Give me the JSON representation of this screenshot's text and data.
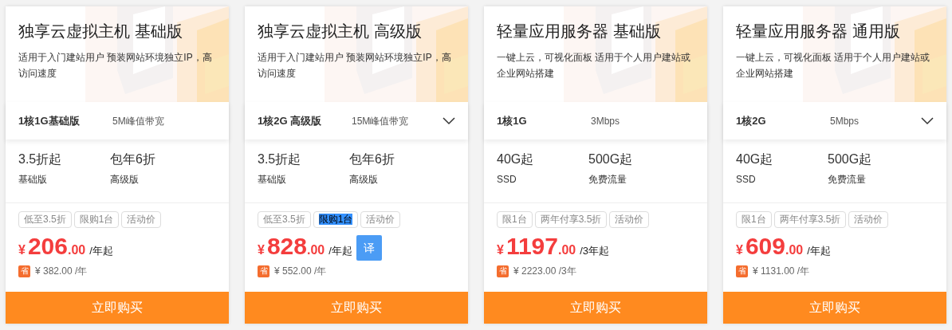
{
  "cards": [
    {
      "title": "独享云虚拟主机 基础版",
      "description": "适用于入门建站用户 预装网站环境独立IP，高访问速度",
      "spec": "1核1G基础版",
      "bandwidth": "5M峰值带宽",
      "has_dropdown": false,
      "features": [
        {
          "value": "3.5折起",
          "label": "基础版"
        },
        {
          "value": "包年6折",
          "label": "高级版"
        }
      ],
      "tags": [
        {
          "text": "低至3.5折",
          "highlighted": false
        },
        {
          "text": "限购1台",
          "highlighted": false
        },
        {
          "text": "活动价",
          "highlighted": false
        }
      ],
      "currency": "¥",
      "price": "206",
      "decimals": ".00",
      "unit": "/年起",
      "save_badge": "省",
      "saving": "¥ 382.00 /年",
      "buy": "立即购买"
    },
    {
      "title": "独享云虚拟主机 高级版",
      "description": "适用于入门建站用户 预装网站环境独立IP，高访问速度",
      "spec": "1核2G 高级版",
      "bandwidth": "15M峰值带宽",
      "has_dropdown": true,
      "features": [
        {
          "value": "3.5折起",
          "label": "基础版"
        },
        {
          "value": "包年6折",
          "label": "高级版"
        }
      ],
      "tags": [
        {
          "text": "低至3.5折",
          "highlighted": false
        },
        {
          "text": "限购1台",
          "highlighted": true
        },
        {
          "text": "活动价",
          "highlighted": false
        }
      ],
      "currency": "¥",
      "price": "828",
      "decimals": ".00",
      "unit": "/年起",
      "save_badge": "省",
      "saving": "¥ 552.00 /年",
      "buy": "立即购买",
      "translate_button": "译"
    },
    {
      "title": "轻量应用服务器 基础版",
      "description": "一键上云，可视化面板 适用于个人用户建站或企业网站搭建",
      "spec": "1核1G",
      "bandwidth": "3Mbps",
      "has_dropdown": false,
      "features": [
        {
          "value": "40G起",
          "label": "SSD"
        },
        {
          "value": "500G起",
          "label": "免费流量"
        }
      ],
      "tags": [
        {
          "text": "限1台",
          "highlighted": false
        },
        {
          "text": "两年付享3.5折",
          "highlighted": false
        },
        {
          "text": "活动价",
          "highlighted": false
        }
      ],
      "currency": "¥",
      "price": "1197",
      "decimals": ".00",
      "unit": "/3年起",
      "save_badge": "省",
      "saving": "¥ 2223.00 /3年",
      "buy": "立即购买"
    },
    {
      "title": "轻量应用服务器 通用版",
      "description": "一键上云，可视化面板 适用于个人用户建站或企业网站搭建",
      "spec": "1核2G",
      "bandwidth": "5Mbps",
      "has_dropdown": true,
      "features": [
        {
          "value": "40G起",
          "label": "SSD"
        },
        {
          "value": "500G起",
          "label": "免费流量"
        }
      ],
      "tags": [
        {
          "text": "限1台",
          "highlighted": false
        },
        {
          "text": "两年付享3.5折",
          "highlighted": false
        },
        {
          "text": "活动价",
          "highlighted": false
        }
      ],
      "currency": "¥",
      "price": "609",
      "decimals": ".00",
      "unit": "/年起",
      "save_badge": "省",
      "saving": "¥ 1131.00 /年",
      "buy": "立即购买"
    }
  ]
}
